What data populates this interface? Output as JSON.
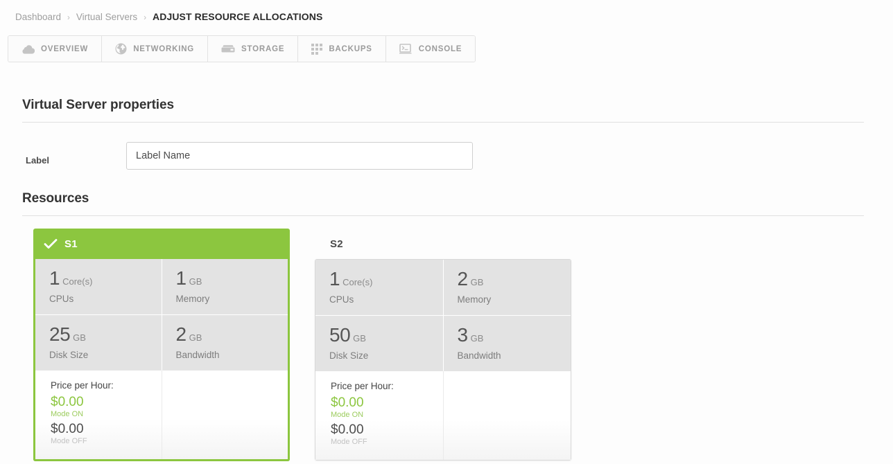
{
  "breadcrumb": {
    "items": [
      "Dashboard",
      "Virtual Servers"
    ],
    "separator": "›",
    "current": "ADJUST RESOURCE ALLOCATIONS"
  },
  "tabs": [
    {
      "label": "OVERVIEW",
      "icon": "cloud-icon"
    },
    {
      "label": "NETWORKING",
      "icon": "globe-icon"
    },
    {
      "label": "STORAGE",
      "icon": "server-icon"
    },
    {
      "label": "BACKUPS",
      "icon": "grid-icon"
    },
    {
      "label": "CONSOLE",
      "icon": "terminal-icon"
    }
  ],
  "properties": {
    "heading": "Virtual Server properties",
    "label_caption": "Label",
    "label_value": "",
    "label_placeholder": "Label Name"
  },
  "resources": {
    "heading": "Resources",
    "price_title": "Price per Hour:",
    "mode_on_label": "Mode ON",
    "mode_off_label": "Mode OFF",
    "selected_check": "✓",
    "cards": [
      {
        "name": "S1",
        "selected": true,
        "specs": [
          {
            "value": "1",
            "unit": "Core(s)",
            "caption": "CPUs"
          },
          {
            "value": "1",
            "unit": "GB",
            "caption": "Memory"
          },
          {
            "value": "25",
            "unit": "GB",
            "caption": "Disk Size"
          },
          {
            "value": "2",
            "unit": "GB",
            "caption": "Bandwidth"
          }
        ],
        "price_on": "$0.00",
        "price_off": "$0.00"
      },
      {
        "name": "S2",
        "selected": false,
        "specs": [
          {
            "value": "1",
            "unit": "Core(s)",
            "caption": "CPUs"
          },
          {
            "value": "2",
            "unit": "GB",
            "caption": "Memory"
          },
          {
            "value": "50",
            "unit": "GB",
            "caption": "Disk Size"
          },
          {
            "value": "3",
            "unit": "GB",
            "caption": "Bandwidth"
          }
        ],
        "price_on": "$0.00",
        "price_off": "$0.00"
      }
    ]
  },
  "colors": {
    "accent_green": "#8cc63f",
    "price_on_green": "#8cc63f",
    "tile_gray": "#e3e3e3",
    "page_bg": "#fdfdfd",
    "text_dark": "#333333",
    "text_muted": "#9a9a9a"
  }
}
